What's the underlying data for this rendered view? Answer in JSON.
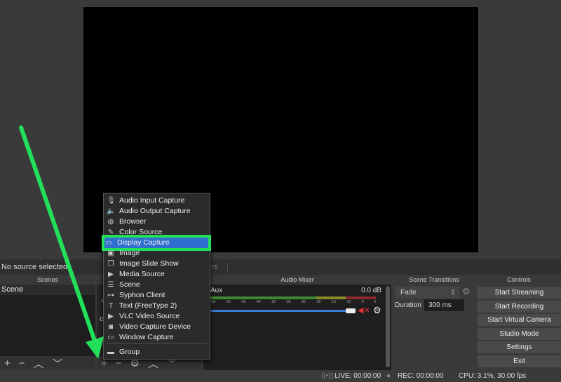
{
  "source_bar": {
    "no_source": "No source selected",
    "filters_tab": "ers"
  },
  "docks": {
    "scenes": "Scenes",
    "audio_mixer": "Audio Mixer",
    "scene_transitions": "Scene Transitions",
    "controls": "Controls"
  },
  "scenes": [
    "Scene"
  ],
  "sources_hint": {
    "line1": "Yo",
    "line2": "or"
  },
  "audio": {
    "channel": "Aux",
    "level": "0.0 dB",
    "ticks": [
      "-55",
      "-50",
      "-45",
      "-40",
      "-35",
      "-30",
      "-25",
      "-20",
      "-15",
      "-10",
      "-5",
      "0"
    ],
    "muted": true
  },
  "transitions": {
    "type": "Fade",
    "duration_label": "Duration",
    "duration": "300 ms"
  },
  "controls": [
    "Start Streaming",
    "Start Recording",
    "Start Virtual Camera",
    "Studio Mode",
    "Settings",
    "Exit"
  ],
  "status": {
    "live": "LIVE: 00:00:00",
    "rec": "REC: 00:00:00",
    "cpu": "CPU: 3.1%, 30.00 fps"
  },
  "menu": {
    "items": [
      {
        "label": "Audio Input Capture",
        "icon": "microphone-icon",
        "glyph": "🎙"
      },
      {
        "label": "Audio Output Capture",
        "icon": "speaker-icon",
        "glyph": "🔈"
      },
      {
        "label": "Browser",
        "icon": "globe-icon",
        "glyph": "◍"
      },
      {
        "label": "Color Source",
        "icon": "brush-icon",
        "glyph": "✎"
      },
      {
        "label": "Display Capture",
        "icon": "monitor-icon",
        "glyph": "▭"
      },
      {
        "label": "Image",
        "icon": "image-icon",
        "glyph": "▣"
      },
      {
        "label": "Image Slide Show",
        "icon": "slideshow-icon",
        "glyph": "❐"
      },
      {
        "label": "Media Source",
        "icon": "play-icon",
        "glyph": "▶"
      },
      {
        "label": "Scene",
        "icon": "list-icon",
        "glyph": "☰"
      },
      {
        "label": "Syphon Client",
        "icon": "syphon-icon",
        "glyph": "⊶"
      },
      {
        "label": "Text (FreeType 2)",
        "icon": "text-icon",
        "glyph": "T"
      },
      {
        "label": "VLC Video Source",
        "icon": "play-icon",
        "glyph": "▶"
      },
      {
        "label": "Video Capture Device",
        "icon": "camera-icon",
        "glyph": "◙"
      },
      {
        "label": "Window Capture",
        "icon": "window-icon",
        "glyph": "▭"
      },
      {
        "label": "Group",
        "icon": "folder-icon",
        "glyph": "▬"
      }
    ],
    "highlighted": "Display Capture"
  },
  "colors": {
    "highlight": "#2f6fd0",
    "annotation": "#22e05a"
  }
}
